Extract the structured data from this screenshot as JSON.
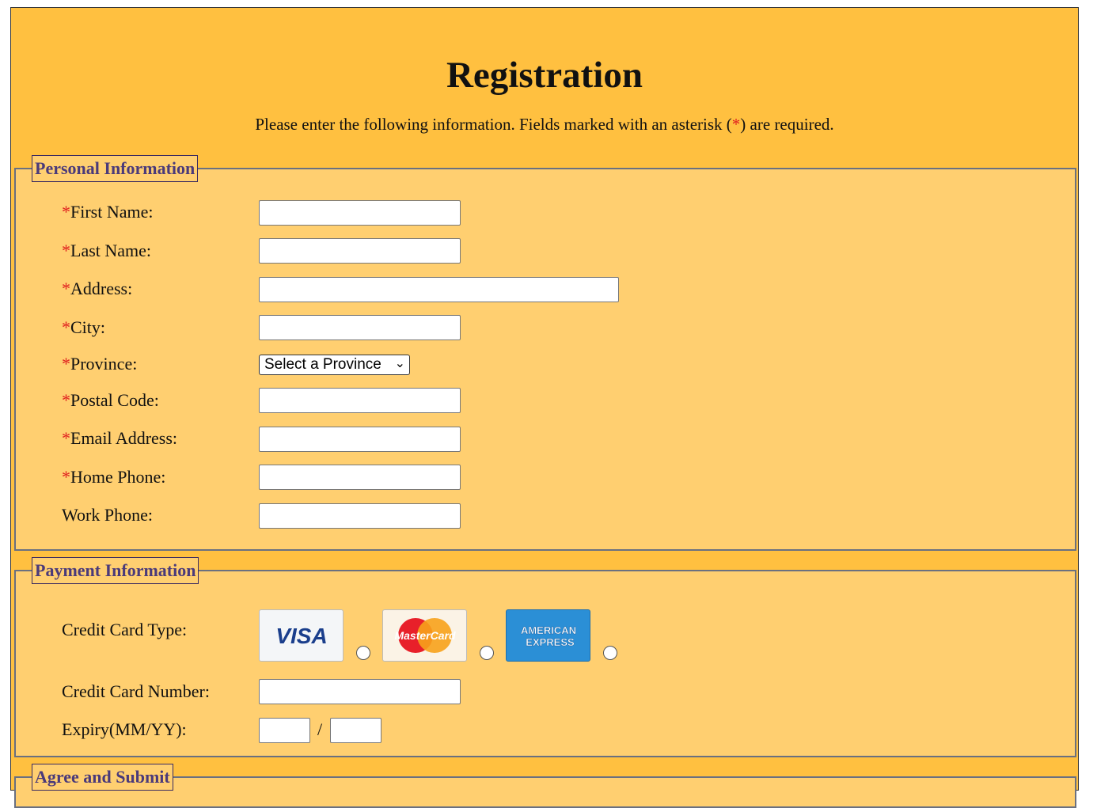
{
  "header": {
    "title": "Registration",
    "intro_before": "Please enter the following information. Fields marked with an asterisk (",
    "intro_asterisk": "*",
    "intro_after": ") are required."
  },
  "personal": {
    "legend": "Personal Information",
    "asterisk": "*",
    "first_name": "First Name:",
    "last_name": "Last Name:",
    "address": "Address:",
    "city": "City:",
    "province": "Province:",
    "province_selected": "Select a Province",
    "postal_code": "Postal Code:",
    "email": "Email Address:",
    "home_phone": "Home Phone:",
    "work_phone": "Work Phone:"
  },
  "payment": {
    "legend": "Payment Information",
    "card_type_label": "Credit Card Type:",
    "cards": [
      {
        "name": "VISA"
      },
      {
        "name": "MasterCard"
      },
      {
        "name": "AMERICAN EXPRESS"
      }
    ],
    "card_number_label": "Credit Card Number:",
    "expiry_label": "Expiry(MM/YY):",
    "expiry_separator": "/"
  },
  "submit": {
    "legend": "Agree and Submit"
  },
  "colors": {
    "page_bg": "#ffc040",
    "section_bg": "#ffcf70",
    "legend_text": "#4a3a7a",
    "asterisk": "#e02020"
  }
}
